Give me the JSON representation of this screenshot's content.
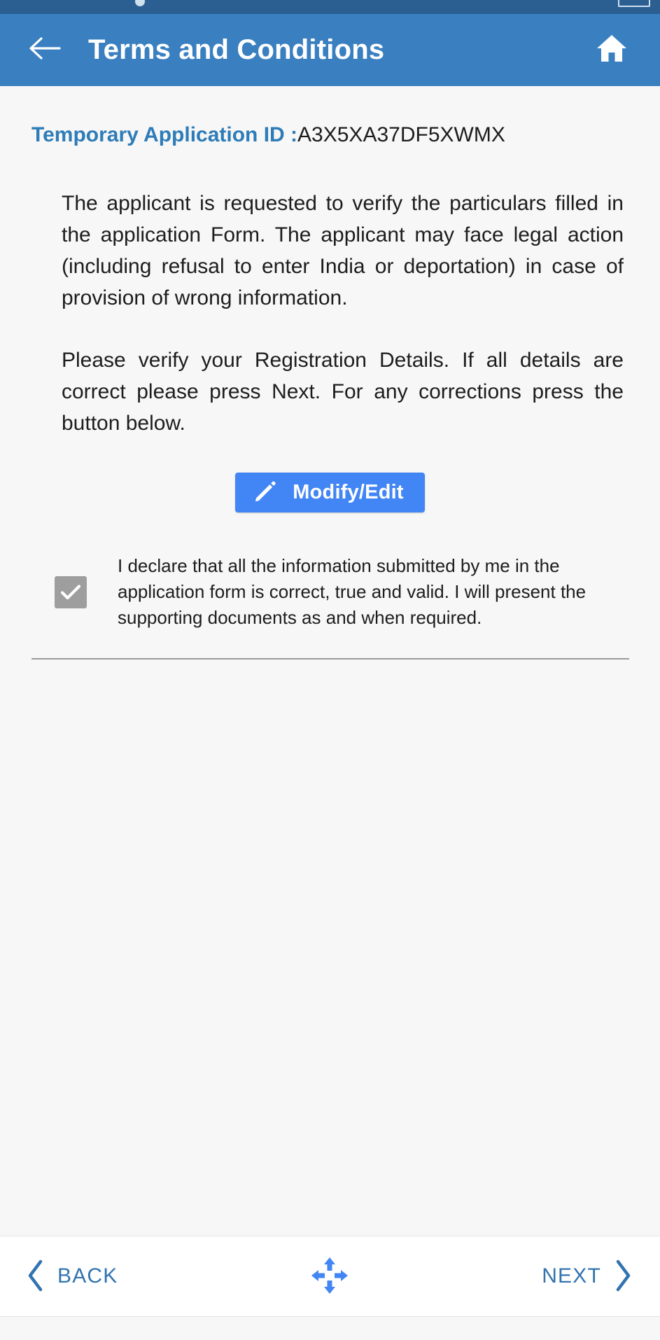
{
  "statusbar": {
    "left_text": "",
    "right_text": ""
  },
  "header": {
    "title": "Terms and Conditions",
    "back_icon": "arrow-left-icon",
    "home_icon": "home-icon",
    "background_color": "#3A80C1"
  },
  "application": {
    "id_label": "Temporary Application ID :",
    "id_value": "A3X5XA37DF5XWMX",
    "label_color": "#2E7CB8"
  },
  "body": {
    "paragraph_1": "The applicant is requested to verify the particulars filled in the application Form. The applicant may face legal action (including refusal to enter India or deportation) in case of provision of wrong information.",
    "paragraph_2": " Please verify your Registration Details. If all details are correct please press Next. For any corrections press the button below."
  },
  "modify_button": {
    "label": "Modify/Edit",
    "icon": "pencil-icon",
    "background_color": "#4285F4"
  },
  "declaration": {
    "checked": true,
    "checkbox_color": "#9E9E9E",
    "text": "I declare that all the information submitted by me in the application form is correct, true and valid. I will present the supporting documents as and when required."
  },
  "bottom_nav": {
    "back_label": "BACK",
    "back_icon": "chevron-left-icon",
    "middle_icon": "move-arrows-icon",
    "next_label": "NEXT",
    "next_icon": "chevron-right-icon",
    "accent_color": "#3273B0"
  }
}
